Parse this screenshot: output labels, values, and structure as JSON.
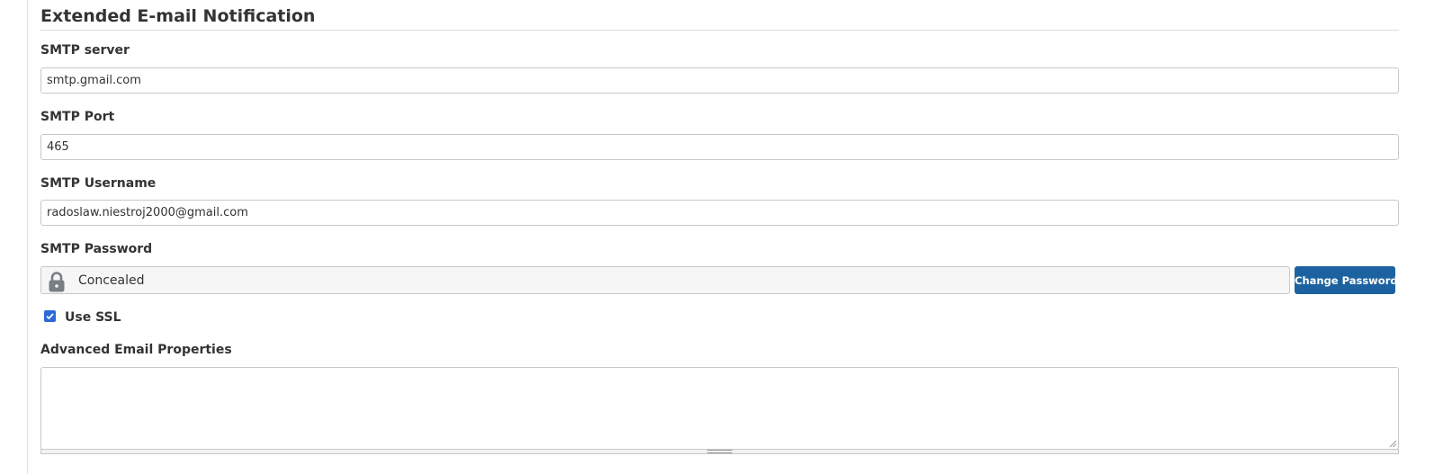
{
  "section": {
    "title": "Extended E-mail Notification"
  },
  "fields": {
    "smtp_server": {
      "label": "SMTP server",
      "value": "smtp.gmail.com"
    },
    "smtp_port": {
      "label": "SMTP Port",
      "value": "465"
    },
    "smtp_username": {
      "label": "SMTP Username",
      "value": "radoslaw.niestroj2000@gmail.com"
    },
    "smtp_password": {
      "label": "SMTP Password",
      "display": "Concealed",
      "icon": "lock-icon",
      "change_button": "Change Password"
    },
    "use_ssl": {
      "label": "Use SSL",
      "checked": true
    },
    "advanced_properties": {
      "label": "Advanced Email Properties",
      "value": ""
    }
  },
  "colors": {
    "button_bg": "#1d62a0",
    "checkbox": "#2a6ad6",
    "lock_icon": "#7a7f85"
  }
}
